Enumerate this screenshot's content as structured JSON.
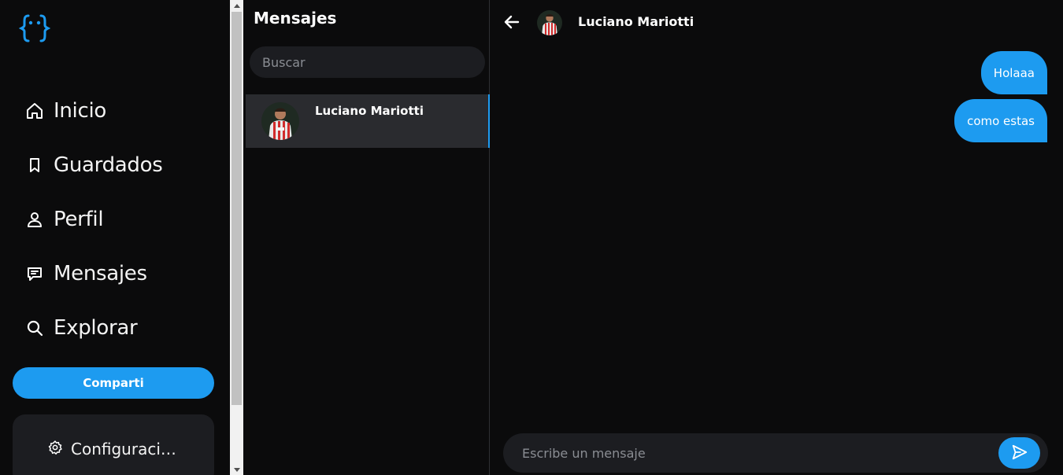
{
  "sidebar": {
    "logo_icon": "curly-braces-eyes-icon",
    "items": [
      {
        "label": "Inicio",
        "icon": "home-icon"
      },
      {
        "label": "Guardados",
        "icon": "bookmark-icon"
      },
      {
        "label": "Perfil",
        "icon": "user-icon"
      },
      {
        "label": "Mensajes",
        "icon": "message-icon"
      },
      {
        "label": "Explorar",
        "icon": "search-icon"
      }
    ],
    "share_label": "Comparti",
    "config_label": "Configuraci…"
  },
  "messages_panel": {
    "title": "Mensajes",
    "search_placeholder": "Buscar",
    "conversations": [
      {
        "name": "Luciano Mariotti",
        "active": true
      }
    ]
  },
  "chat": {
    "contact_name": "Luciano Mariotti",
    "messages": [
      {
        "text": "Holaaa",
        "sent": true
      },
      {
        "text": "como estas",
        "sent": true
      }
    ],
    "input_placeholder": "Escribe un mensaje"
  },
  "colors": {
    "accent": "#1d9bf0",
    "background": "#0b0b0c",
    "surface": "#1c1d21",
    "active_row": "#2a2b2f"
  }
}
